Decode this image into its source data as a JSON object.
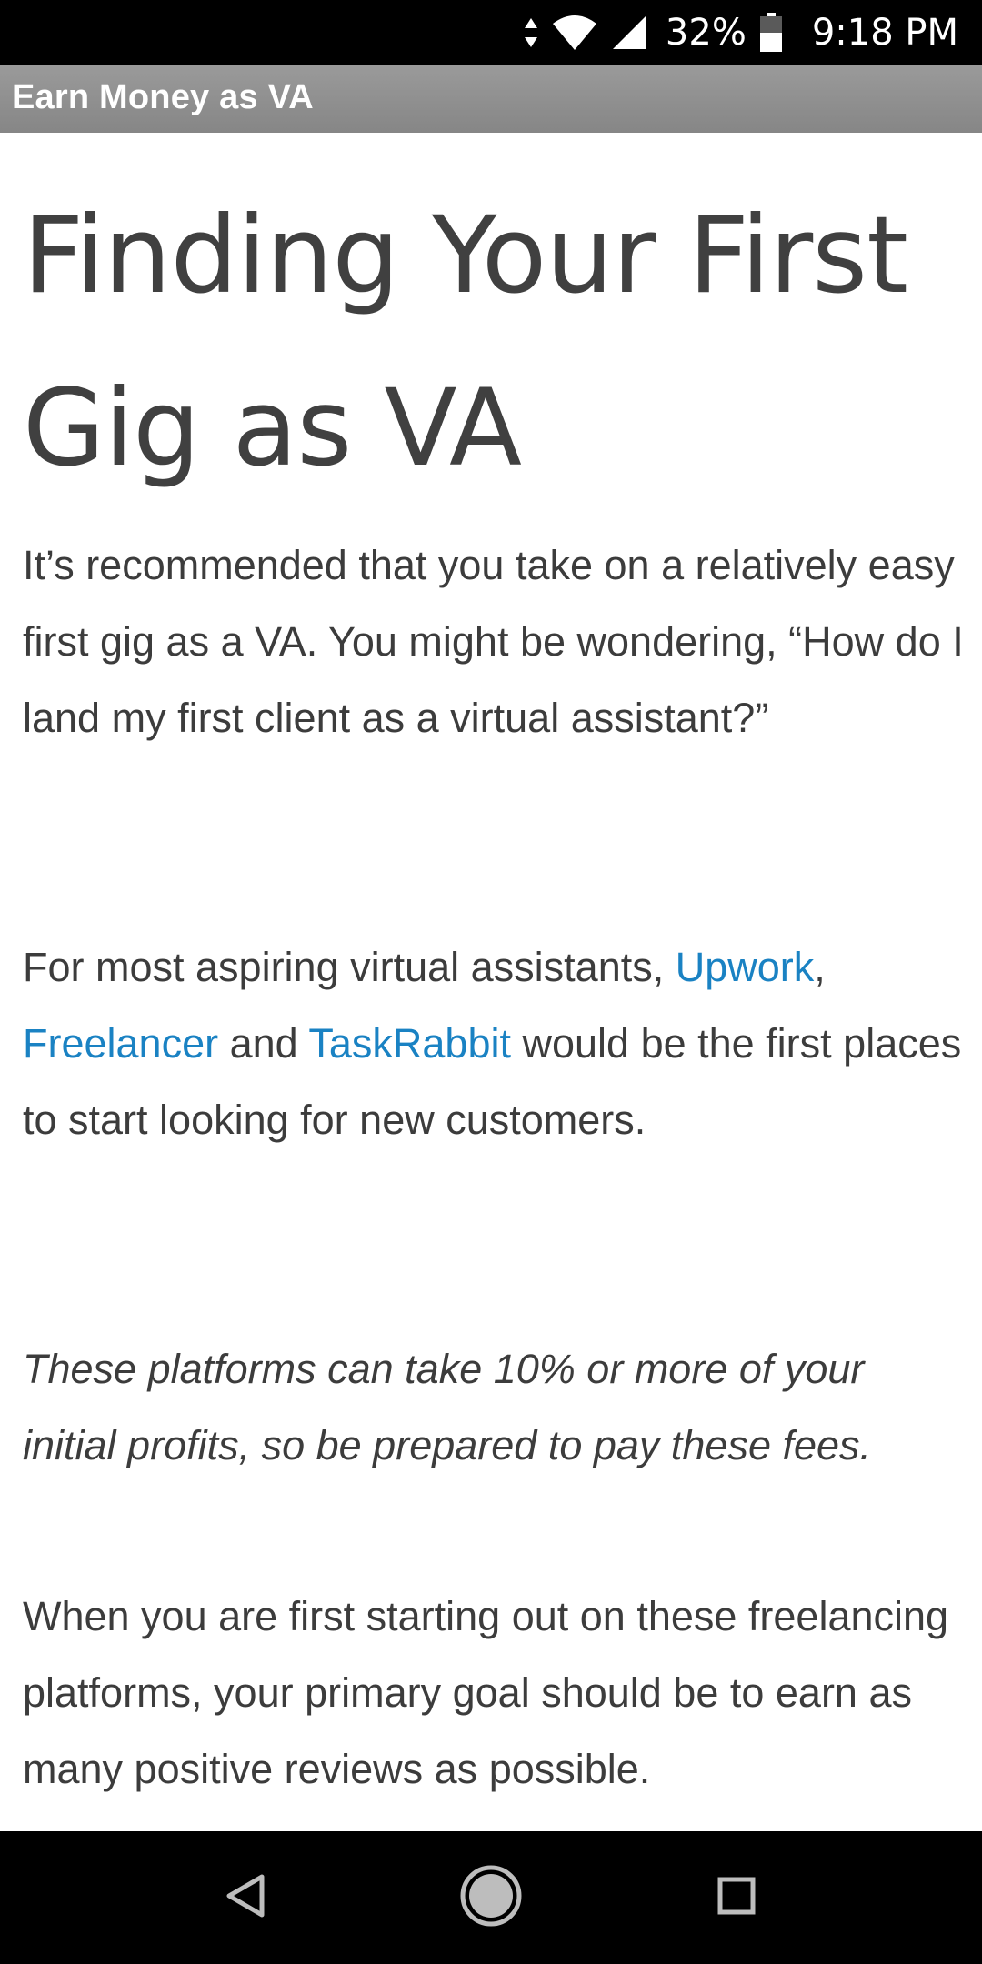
{
  "status_bar": {
    "battery_percent": "32%",
    "time": "9:18 PM",
    "icons": [
      "data-arrows-icon",
      "wifi-icon",
      "cell-signal-icon",
      "battery-icon"
    ]
  },
  "app_bar": {
    "title": "Earn Money as VA"
  },
  "article": {
    "title": "Finding Your First Gig as VA",
    "paragraph1": "It’s recommended that you take on a relatively easy first gig as a VA. You might be wondering, “How do I land my first client as a virtual assistant?”",
    "paragraph2": {
      "text_before": "For most aspiring virtual assistants, ",
      "link1": "Upwork",
      "sep1": ", ",
      "link2": "Freelancer",
      "sep2": " and ",
      "link3": "TaskRabbit",
      "text_after": " would be the first places to start looking for new customers."
    },
    "paragraph3": "These platforms can take 10% or more of your initial profits, so be prepared to pay these fees.",
    "paragraph4": "When you are first starting out on these freelancing platforms, your primary goal should be to earn as many positive reviews as possible."
  },
  "nav_bar": {
    "icons": [
      "back-icon",
      "home-icon",
      "recents-icon"
    ]
  },
  "colors": {
    "link": "#1a82c3",
    "text": "#3c3c3c",
    "app_bar": "#8e8e8e",
    "system_bars": "#000000"
  }
}
